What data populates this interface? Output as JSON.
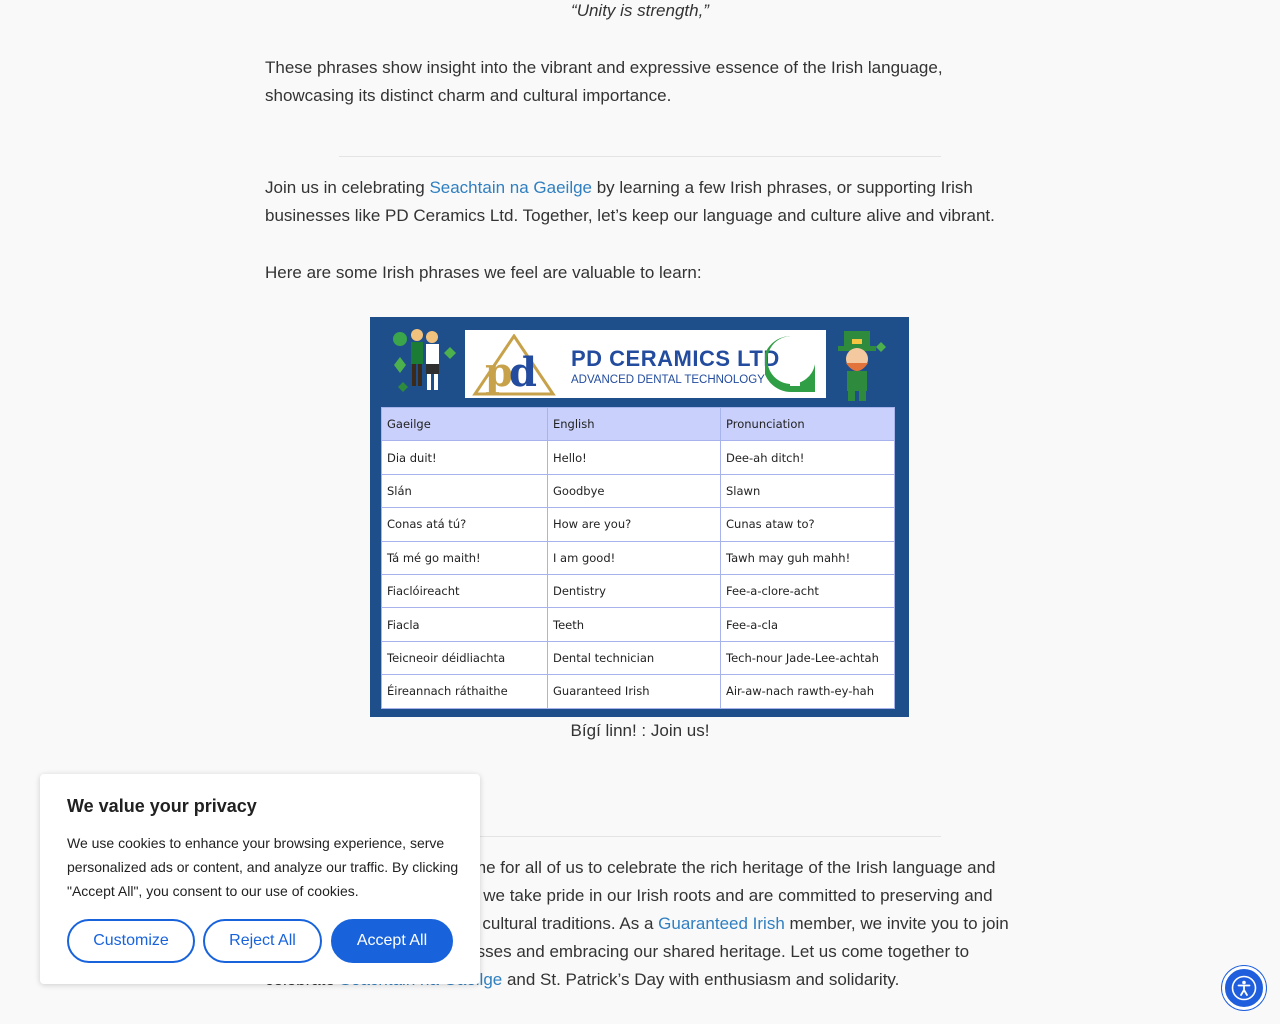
{
  "article": {
    "quote": "“Unity is strength,”",
    "para1": "These phrases show insight into the vibrant and expressive essence of the Irish language, showcasing its distinct charm and cultural importance.",
    "para2_pre": "Join us in celebrating ",
    "para2_link": "Seachtain na Gaeilge",
    "para2_post": " by learning a few Irish phrases, or supporting Irish businesses like PD Ceramics Ltd. Together, let’s keep our language and culture alive and vibrant.",
    "para3": "Here are some Irish phrases we feel are valuable to learn:",
    "caption": "Bígí linn! : Join us!",
    "para4_pre": "Seachtain na Gaeilge is a time for all of us to celebrate the rich heritage of the Irish language and culture. At PD Ceramics Ltd, we take pride in our Irish roots and are committed to preserving and promoting our language and cultural traditions. As a ",
    "para4_link1": "Guaranteed Irish",
    "para4_mid": " member, we invite you to join us in supporting Irish businesses and embracing our shared heritage. Let us come together to celebrate ",
    "para4_link2": "Seachtain na Gaeilge",
    "para4_post": " and St. Patrick’s Day with enthusiasm and solidarity."
  },
  "image": {
    "brand_name": "PD CERAMICS LTD",
    "brand_sub": "ADVANCED DENTAL TECHNOLOGY",
    "headers": [
      "Gaeilge",
      "English",
      "Pronunciation"
    ],
    "rows": [
      [
        "Dia duit!",
        "Hello!",
        "Dee-ah  ditch!"
      ],
      [
        "Slán",
        "Goodbye",
        "Slawn"
      ],
      [
        "Conas atá tú?",
        "How are you?",
        "Cunas ataw to?"
      ],
      [
        "Tá mé go maith!",
        "I am good!",
        "Tawh may guh mahh!"
      ],
      [
        "Fiaclóireacht",
        "Dentistry",
        "Fee-a-clore-acht"
      ],
      [
        "Fiacla",
        "Teeth",
        "Fee-a-cla"
      ],
      [
        "Teicneoir déidliachta",
        "Dental technician",
        "Tech-nour Jade-Lee-achtah"
      ],
      [
        "Éireannach ráthaithe",
        "Guaranteed Irish",
        "Air-aw-nach  rawth-ey-hah"
      ]
    ]
  },
  "privacy": {
    "title": "We value your privacy",
    "message": "We use cookies to enhance your browsing experience, serve personalized ads or content, and analyze our traffic. By clicking \"Accept All\", you consent to our use of cookies.",
    "customize": "Customize",
    "reject": "Reject All",
    "accept": "Accept All"
  },
  "colors": {
    "link": "#2f7fc1",
    "accent": "#1863dc",
    "card": "#1f4f8b",
    "table_head": "#c9d0fb"
  }
}
